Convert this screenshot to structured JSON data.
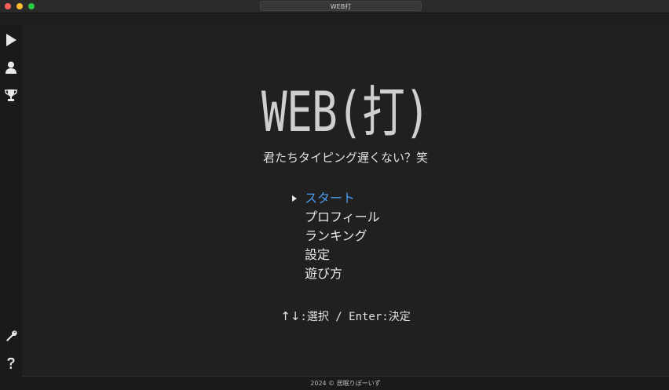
{
  "window": {
    "title": "WEB打"
  },
  "sidebar": {
    "items": [
      {
        "icon": "play-icon"
      },
      {
        "icon": "user-icon"
      },
      {
        "icon": "trophy-icon"
      }
    ],
    "bottom_items": [
      {
        "icon": "wrench-icon"
      },
      {
        "icon": "help-icon"
      }
    ]
  },
  "main": {
    "logo": "WEB(打)",
    "tagline": "君たちタイピング遅くない？笑",
    "menu": [
      {
        "label": "スタート",
        "selected": true
      },
      {
        "label": "プロフィール",
        "selected": false
      },
      {
        "label": "ランキング",
        "selected": false
      },
      {
        "label": "設定",
        "selected": false
      },
      {
        "label": "遊び方",
        "selected": false
      }
    ],
    "hint_arrows": "↑↓",
    "hint_text": ":選択 / Enter:決定"
  },
  "footer": {
    "text": "2024 © 居眠りぽーいず"
  },
  "colors": {
    "accent": "#4a9df2",
    "background": "#202020",
    "sidebar": "#1a1a1a"
  }
}
